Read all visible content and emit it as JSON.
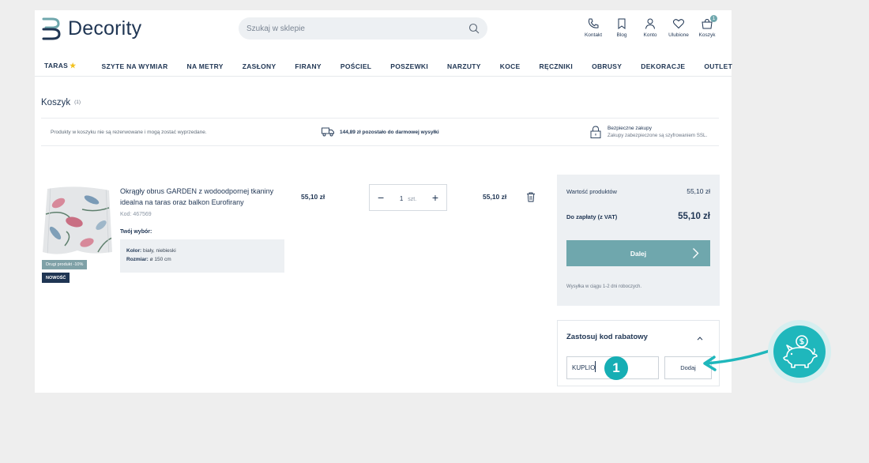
{
  "brand": {
    "name": "Decority"
  },
  "search": {
    "placeholder": "Szukaj w sklepie"
  },
  "header_icons": [
    {
      "label": "Kontakt",
      "icon": "phone-icon"
    },
    {
      "label": "Blog",
      "icon": "bookmark-icon"
    },
    {
      "label": "Konto",
      "icon": "user-icon"
    },
    {
      "label": "Ulubione",
      "icon": "heart-icon"
    },
    {
      "label": "Koszyk",
      "icon": "cart-icon",
      "badge": "1"
    }
  ],
  "nav": {
    "items": [
      "TARAS",
      "SZYTE NA WYMIAR",
      "NA METRY",
      "ZASŁONY",
      "FIRANY",
      "POŚCIEL",
      "POSZEWKI",
      "NARZUTY",
      "KOCE",
      "RĘCZNIKI",
      "OBRUSY",
      "DEKORACJE",
      "OUTLET"
    ],
    "taras_star": "★"
  },
  "cart": {
    "title": "Koszyk",
    "count": "(1)",
    "info_left": "Produkty w koszyku nie są rezerwowane i mogą zostać wyprzedane.",
    "info_shipping": "144,89 zł pozostało do darmowej wysyłki",
    "secure_title": "Bezpieczne zakupy",
    "secure_sub": "Zakupy zabezpieczone są szyfrowaniem SSL."
  },
  "product": {
    "name": "Okrągły obrus GARDEN z wodoodpornej tkaniny idealna na taras oraz balkon Eurofirany",
    "code": "Kod: 467569",
    "choice_label": "Twój wybór:",
    "color_label": "Kolor:",
    "color_value": "biały, niebieski",
    "size_label": "Rozmiar:",
    "size_value": "ø 150 cm",
    "badge_second": "Drugi produkt -10%",
    "badge_new": "NOWOŚĆ",
    "price": "55,10 zł",
    "qty_minus": "−",
    "qty": "1",
    "qty_unit": "szt.",
    "qty_plus": "+",
    "total": "55,10 zł"
  },
  "summary": {
    "products_value_label": "Wartość produktów",
    "products_value": "55,10 zł",
    "to_pay_label": "Do zapłaty (z VAT)",
    "to_pay": "55,10 zł",
    "next_label": "Dalej",
    "shipping_note": "Wysyłka w ciągu 1-2 dni roboczych."
  },
  "discount": {
    "title": "Zastosuj kod rabatowy",
    "code_value": "KUPLIO",
    "add_label": "Dodaj"
  },
  "annotation": {
    "step": "1",
    "accent": "#16aeb4"
  },
  "colors": {
    "primary": "#1f3553",
    "teal_button": "#6fa7ad",
    "panel_bg": "#edf0f3"
  }
}
